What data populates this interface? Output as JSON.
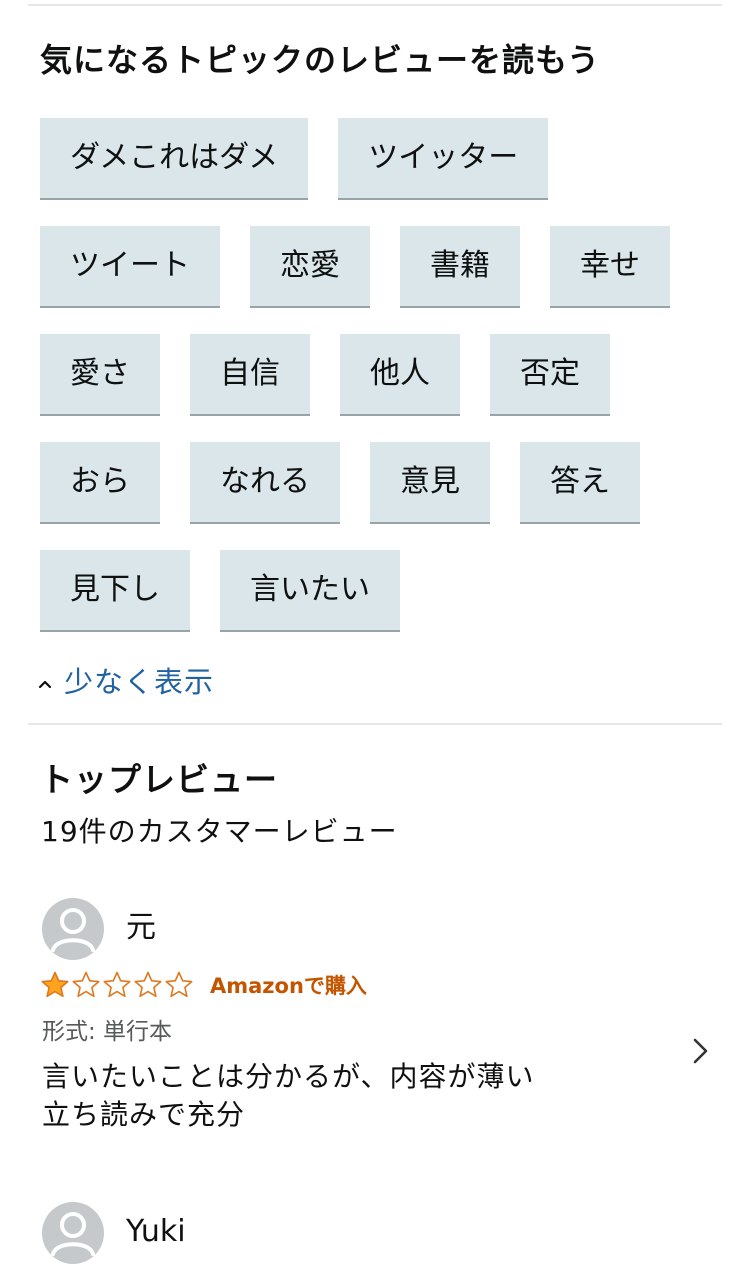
{
  "topics": {
    "title": "気になるトピックのレビューを読もう",
    "chips": [
      "ダメこれはダメ",
      "ツイッター",
      "ツイート",
      "恋愛",
      "書籍",
      "幸せ",
      "愛さ",
      "自信",
      "他人",
      "否定",
      "おら",
      "なれる",
      "意見",
      "答え",
      "見下し",
      "言いたい"
    ],
    "show_less_label": "少なく表示"
  },
  "top_reviews": {
    "title": "トップレビュー",
    "count_label": "19件のカスタマーレビュー"
  },
  "reviews": [
    {
      "name": "元",
      "rating": 1,
      "max_rating": 5,
      "verified_label": "Amazonで購入",
      "format_label": "形式: 単行本",
      "body_lines": [
        "言いたいことは分かるが、内容が薄い",
        "立ち読みで充分"
      ]
    },
    {
      "name": "Yuki"
    }
  ],
  "colors": {
    "chip_bg": "#dae6ea",
    "link": "#2162a1",
    "star_fill": "#ffa41c",
    "star_outline": "#de7921",
    "verified": "#c45500"
  },
  "icons": {
    "show_less": "caret-up-icon",
    "avatar": "default-user-icon",
    "star": "star-icon",
    "next": "chevron-right-icon"
  }
}
